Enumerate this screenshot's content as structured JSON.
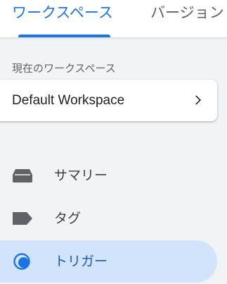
{
  "tabs": [
    {
      "label": "ワークスペース",
      "active": true
    },
    {
      "label": "バージョン",
      "active": false
    }
  ],
  "current_workspace": {
    "section_label": "現在のワークスペース",
    "name": "Default Workspace",
    "chevron_icon": "chevron-right-icon"
  },
  "nav": {
    "items": [
      {
        "label": "サマリー",
        "icon": "summary-inbox-icon",
        "selected": false
      },
      {
        "label": "タグ",
        "icon": "tag-icon",
        "selected": false
      },
      {
        "label": "トリガー",
        "icon": "trigger-icon",
        "selected": true
      }
    ]
  },
  "colors": {
    "accent": "#1a73e8",
    "selected_background": "#d2e3fc",
    "icon_gray": "#5f6368",
    "page_background": "#f1f3f4"
  }
}
